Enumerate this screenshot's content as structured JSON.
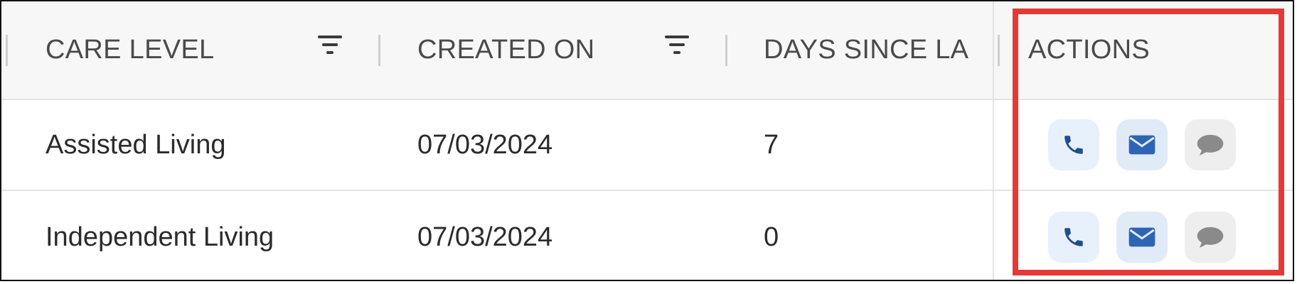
{
  "table": {
    "headers": {
      "care_level": "CARE LEVEL",
      "created_on": "CREATED ON",
      "days_since": "DAYS SINCE LA",
      "actions": "ACTIONS"
    },
    "rows": [
      {
        "care_level": "Assisted Living",
        "created_on": "07/03/2024",
        "days_since": "7"
      },
      {
        "care_level": "Independent Living",
        "created_on": "07/03/2024",
        "days_since": "0"
      }
    ]
  },
  "icons": {
    "filter": "filter-icon",
    "phone": "phone-icon",
    "email": "envelope-icon",
    "chat": "chat-bubble-icon"
  },
  "colors": {
    "phone_icon": "#1f4e8c",
    "email_icon": "#2d64b4",
    "chat_icon": "#8a8a8a",
    "highlight": "#e53935",
    "header_bg": "#f7f7f7"
  }
}
